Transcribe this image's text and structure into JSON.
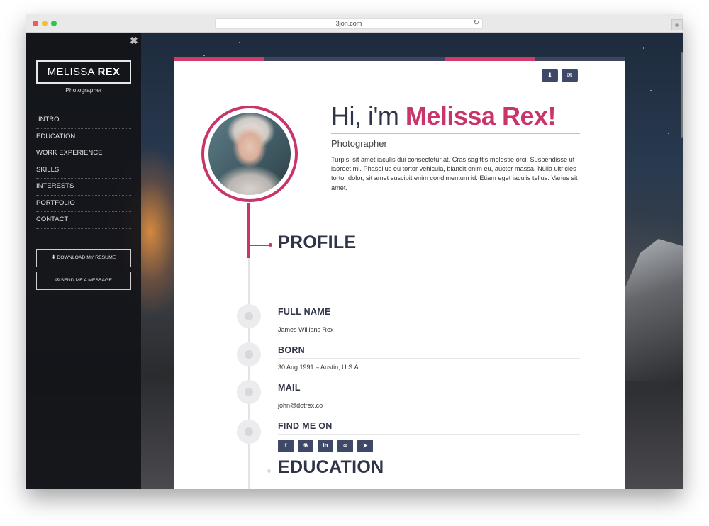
{
  "browser": {
    "url": "3jon.com",
    "reload_icon": "reload-icon",
    "newtab_label": "+"
  },
  "sidebar": {
    "close_label": "✖",
    "logo_first": "MELISSA",
    "logo_last": "REX",
    "subtitle": "Photographer",
    "nav": [
      {
        "label": "INTRO"
      },
      {
        "label": "EDUCATION"
      },
      {
        "label": "WORK EXPERIENCE"
      },
      {
        "label": "SKILLS"
      },
      {
        "label": "INTERESTS"
      },
      {
        "label": "PORTFOLIO"
      },
      {
        "label": "CONTACT"
      }
    ],
    "download_label": "DOWNLOAD MY RESUME",
    "message_label": "SEND ME A MESSAGE"
  },
  "hero": {
    "greeting": "Hi, i'm",
    "name": "Melissa Rex!",
    "role": "Photographer",
    "bio": "Turpis, sit amet iaculis dui consectetur at. Cras sagittis molestie orci. Suspendisse ut laoreet mi. Phasellus eu tortor vehicula, blandit enim eu, auctor massa. Nulla ultricies tortor dolor, sit amet suscipit enim condimentum id. Etiam eget iaculis tellus. Varius sit amet."
  },
  "profile": {
    "title": "PROFILE",
    "fields": [
      {
        "label": "FULL NAME",
        "value": "James Willians Rex"
      },
      {
        "label": "BORN",
        "value": "30 Aug 1991 – Austin, U.S.A"
      },
      {
        "label": "MAIL",
        "value": "john@dotrex.co"
      },
      {
        "label": "FIND ME ON",
        "value": ""
      }
    ],
    "socials": [
      "f",
      "t",
      "in",
      "link",
      "send"
    ]
  },
  "education": {
    "title": "EDUCATION"
  },
  "colors": {
    "accent": "#c9346a",
    "navy": "#3e4868",
    "heading": "#2f3448"
  }
}
